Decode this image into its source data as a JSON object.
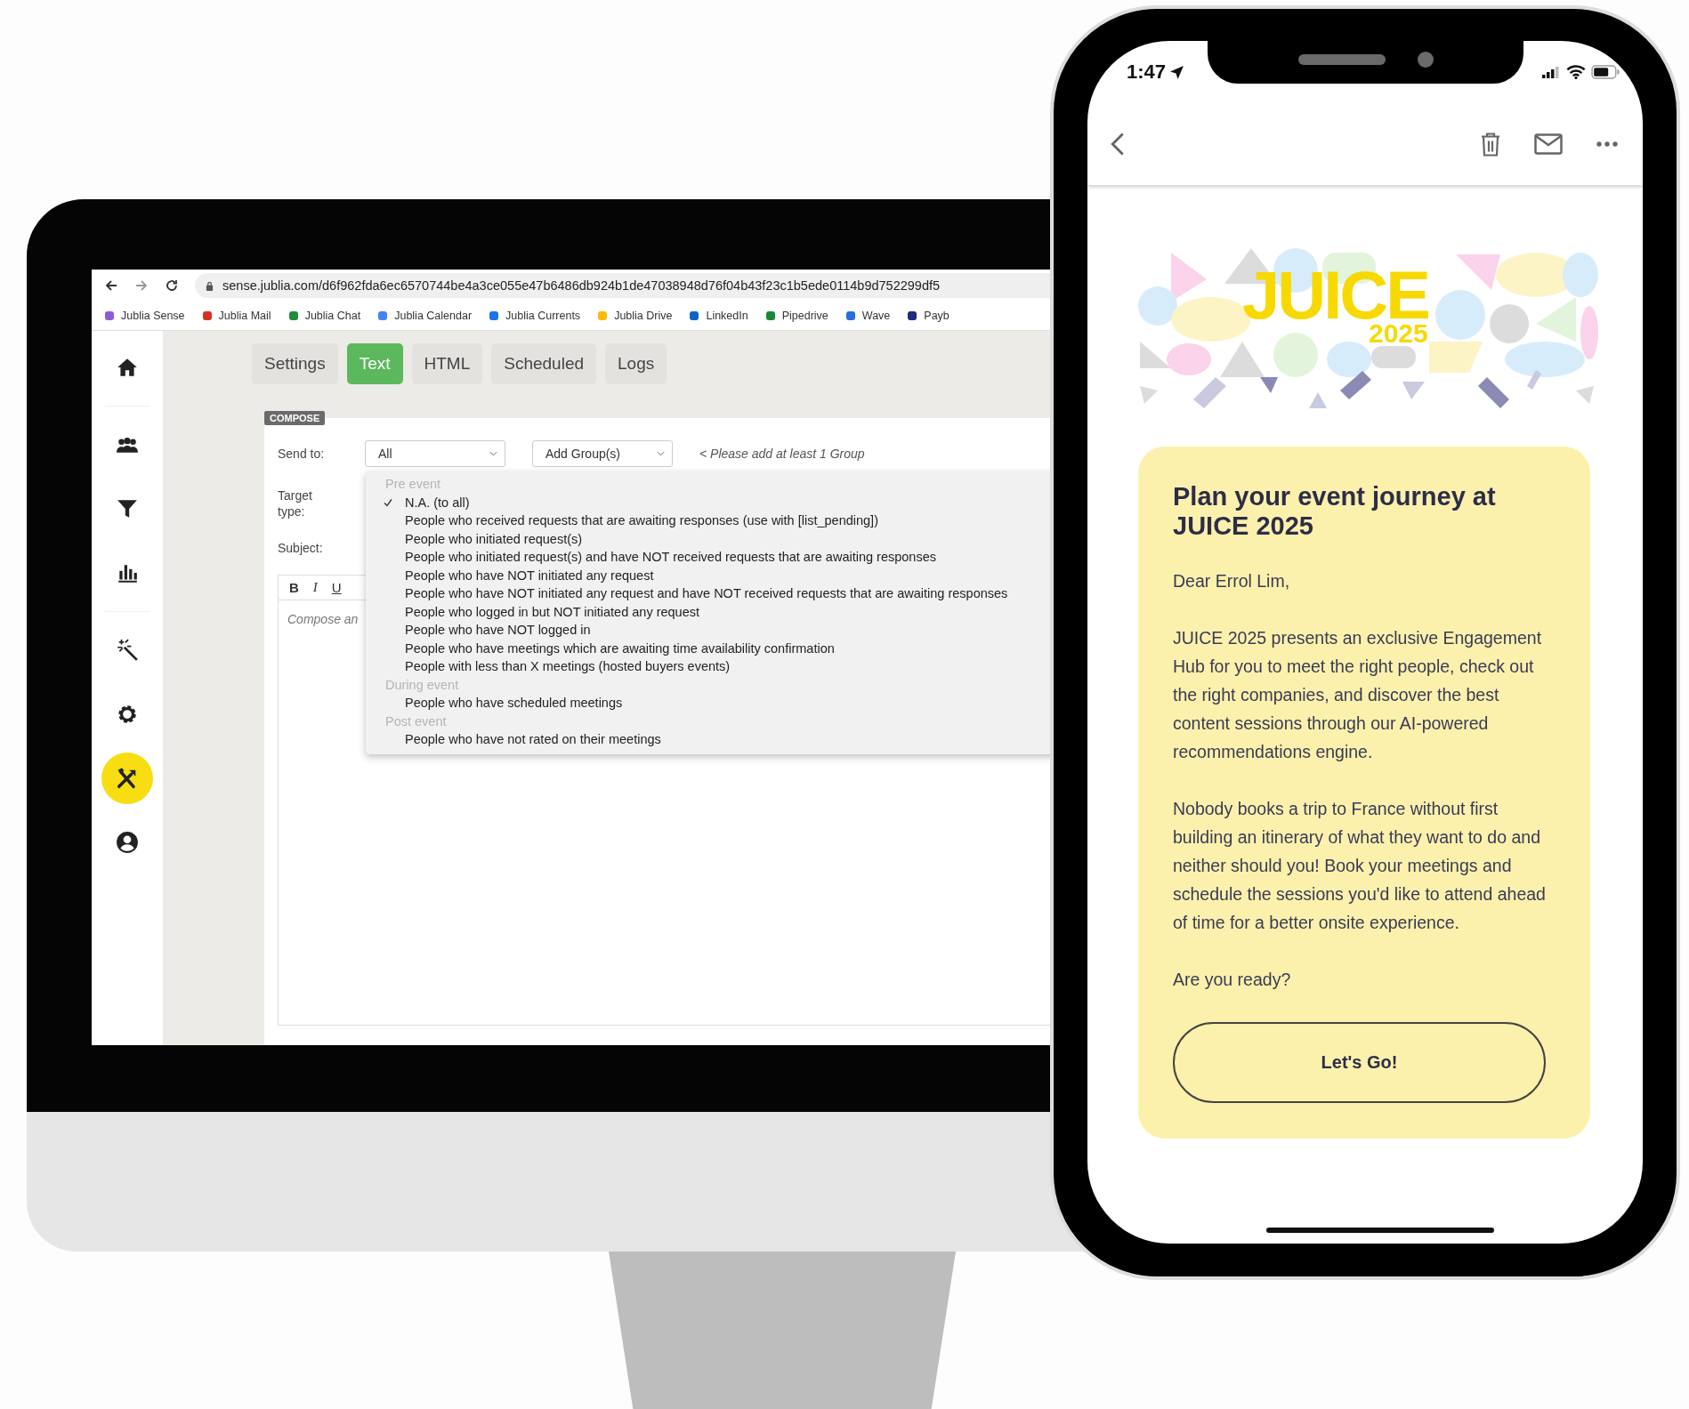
{
  "browser": {
    "url": "sense.jublia.com/d6f962fda6ec6570744be4a3ce055e47b6486db924b1de47038948d76f04b43f23c1b5ede0114b9d752299df5",
    "bookmarks": [
      {
        "label": "Jublia Sense",
        "color": "#8e5bd6"
      },
      {
        "label": "Jublia Mail",
        "color": "#d93025"
      },
      {
        "label": "Jublia Chat",
        "color": "#1e8e3e"
      },
      {
        "label": "Jublia Calendar",
        "color": "#4285f4"
      },
      {
        "label": "Jublia Currents",
        "color": "#1a73e8"
      },
      {
        "label": "Jublia Drive",
        "color": "#fbbc04"
      },
      {
        "label": "LinkedIn",
        "color": "#0a66c2"
      },
      {
        "label": "Pipedrive",
        "color": "#1a8a3a"
      },
      {
        "label": "Wave",
        "color": "#2b6de0"
      },
      {
        "label": "Payb",
        "color": "#1f2a80"
      }
    ]
  },
  "sidebar": {
    "items": [
      {
        "kind": "home",
        "selected": false
      },
      {
        "kind": "people",
        "selected": false
      },
      {
        "kind": "filter",
        "selected": false
      },
      {
        "kind": "chart",
        "selected": false
      },
      {
        "kind": "wand",
        "selected": false
      },
      {
        "kind": "gear",
        "selected": false
      },
      {
        "kind": "tools",
        "selected": true
      },
      {
        "kind": "user",
        "selected": false
      }
    ]
  },
  "tabs": [
    {
      "label": "Settings",
      "selected": false
    },
    {
      "label": "Text",
      "selected": true
    },
    {
      "label": "HTML",
      "selected": false
    },
    {
      "label": "Scheduled",
      "selected": false
    },
    {
      "label": "Logs",
      "selected": false
    }
  ],
  "compose": {
    "badge": "COMPOSE",
    "send_to_label": "Send to:",
    "send_to_value": "All",
    "group_select": "Add Group(s)",
    "group_hint": "< Please add at least 1 Group",
    "target_type_label": "Target type:",
    "subject_label": "Subject:",
    "format_buttons": [
      {
        "label": "B",
        "kind": "bold"
      },
      {
        "label": "I",
        "kind": "italic"
      },
      {
        "label": "U",
        "kind": "underline"
      }
    ],
    "body_placeholder": "Compose an"
  },
  "target_menu": {
    "groups": [
      {
        "label": "Pre event",
        "options": [
          {
            "label": "N.A. (to all)",
            "checked": true
          },
          {
            "label": "People who received requests that are awaiting responses (use with [list_pending])",
            "checked": false
          },
          {
            "label": "People who initiated request(s)",
            "checked": false
          },
          {
            "label": "People who initiated request(s) and have NOT received requests that are awaiting responses",
            "checked": false
          },
          {
            "label": "People who have NOT initiated any request",
            "checked": false
          },
          {
            "label": "People who have NOT initiated any request and have NOT received requests that are awaiting responses",
            "checked": false
          },
          {
            "label": "People who logged in but NOT initiated any request",
            "checked": false
          },
          {
            "label": "People who have NOT logged in",
            "checked": false
          },
          {
            "label": "People who have meetings which are awaiting time availability confirmation",
            "checked": false
          },
          {
            "label": "People with less than X meetings (hosted buyers events)",
            "checked": false
          }
        ]
      },
      {
        "label": "During event",
        "options": [
          {
            "label": "People who have scheduled meetings",
            "checked": false
          }
        ]
      },
      {
        "label": "Post event",
        "options": [
          {
            "label": "People who have not rated on their meetings",
            "checked": false
          }
        ]
      }
    ]
  },
  "phone": {
    "time": "1:47",
    "banner": {
      "logo": "JUICE",
      "year": "2025"
    },
    "email": {
      "title": "Plan your event journey at JUICE 2025",
      "paragraphs": [
        "Dear Errol Lim,",
        "JUICE 2025 presents an exclusive Engagement Hub for you to meet the right people, check out the right companies, and discover the best content sessions through our AI-powered recommendations engine.",
        "Nobody books a trip to France without first building an itinerary of what they want to do and neither should you! Book your meetings and schedule the sessions you'd like to attend ahead of time for a better onsite experience.",
        "Are you ready?"
      ],
      "button": "Let's Go!"
    }
  }
}
